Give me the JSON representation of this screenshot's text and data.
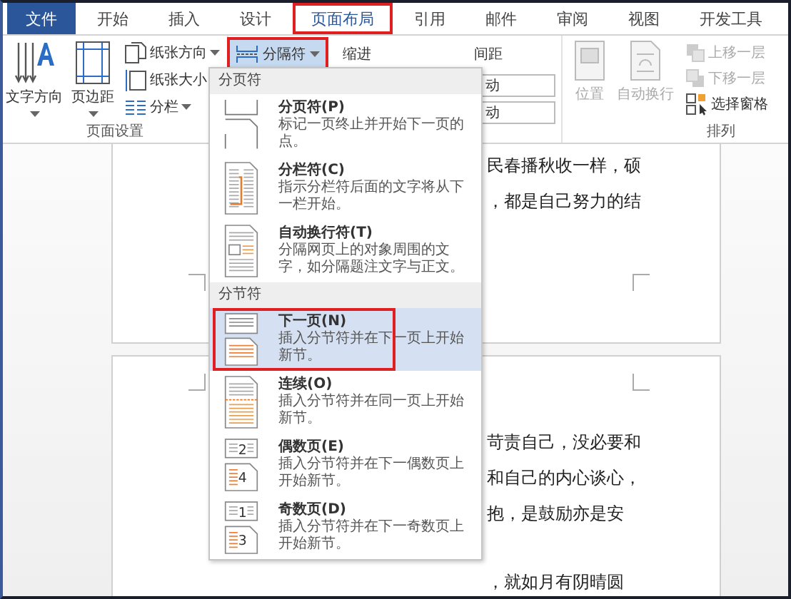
{
  "tabs": [
    {
      "label": "文件",
      "kind": "file",
      "selected": false,
      "highlighted": false
    },
    {
      "label": "开始",
      "kind": "tab",
      "selected": false,
      "highlighted": false
    },
    {
      "label": "插入",
      "kind": "tab",
      "selected": false,
      "highlighted": false
    },
    {
      "label": "设计",
      "kind": "tab",
      "selected": false,
      "highlighted": false
    },
    {
      "label": "页面布局",
      "kind": "tab",
      "selected": true,
      "highlighted": true
    },
    {
      "label": "引用",
      "kind": "tab",
      "selected": false,
      "highlighted": false
    },
    {
      "label": "邮件",
      "kind": "tab",
      "selected": false,
      "highlighted": false
    },
    {
      "label": "审阅",
      "kind": "tab",
      "selected": false,
      "highlighted": false
    },
    {
      "label": "视图",
      "kind": "tab",
      "selected": false,
      "highlighted": false
    },
    {
      "label": "开发工具",
      "kind": "tab",
      "selected": false,
      "highlighted": false
    }
  ],
  "page_setup": {
    "label": "页面设置",
    "large": [
      {
        "label": "文字方向"
      },
      {
        "label": "页边距"
      }
    ],
    "small": [
      {
        "label": "纸张方向"
      },
      {
        "label": "纸张大小"
      },
      {
        "label": "分栏"
      }
    ]
  },
  "breaks_button": {
    "label": "分隔符",
    "highlighted": true,
    "expanded": true
  },
  "paragraph": {
    "indent_label": "缩进",
    "spacing_label": "间距",
    "fields": [
      {
        "value": "动"
      },
      {
        "value": "动"
      }
    ]
  },
  "arrange": {
    "label": "排列",
    "large": [
      {
        "label": "位置",
        "disabled": true
      },
      {
        "label": "自动换行",
        "disabled": true
      }
    ],
    "small": [
      {
        "label": "上移一层",
        "disabled": true
      },
      {
        "label": "下移一层",
        "disabled": true
      },
      {
        "label": "选择窗格",
        "disabled": false
      }
    ]
  },
  "document": {
    "pages": [
      {
        "paragraphs": [
          [
            "民春播秋收一样，硕",
            "，都是自己努力的结"
          ]
        ]
      },
      {
        "paragraphs": [
          [
            "苛责自己，没必要和",
            "和自己的内心谈心，",
            "抱，是鼓励亦是安"
          ],
          [
            "，就如月有阴晴圆"
          ]
        ]
      }
    ]
  },
  "menu": {
    "sections": [
      {
        "header": "分页符",
        "items": [
          {
            "title": "分页符(P)",
            "description": "标记一页终止并开始下一页的点。",
            "kind": "page-break",
            "selected": false,
            "highlighted": false
          },
          {
            "title": "分栏符(C)",
            "description": "指示分栏符后面的文字将从下一栏开始。",
            "kind": "column-break",
            "selected": false,
            "highlighted": false
          },
          {
            "title": "自动换行符(T)",
            "description": "分隔网页上的对象周围的文字，如分隔题注文字与正文。",
            "kind": "text-wrap",
            "selected": false,
            "highlighted": false
          }
        ]
      },
      {
        "header": "分节符",
        "items": [
          {
            "title": "下一页(N)",
            "description": "插入分节符并在下一页上开始新节。",
            "kind": "next-page",
            "selected": true,
            "highlighted": true
          },
          {
            "title": "连续(O)",
            "description": "插入分节符并在同一页上开始新节。",
            "kind": "continuous",
            "selected": false,
            "highlighted": false
          },
          {
            "title": "偶数页(E)",
            "description": "插入分节符并在下一偶数页上开始新节。",
            "kind": "even-page",
            "icon_labels": [
              "2",
              "4"
            ],
            "selected": false,
            "highlighted": false
          },
          {
            "title": "奇数页(D)",
            "description": "插入分节符并在下一奇数页上开始新节。",
            "kind": "odd-page",
            "icon_labels": [
              "1",
              "3"
            ],
            "selected": false,
            "highlighted": false
          }
        ]
      }
    ]
  }
}
